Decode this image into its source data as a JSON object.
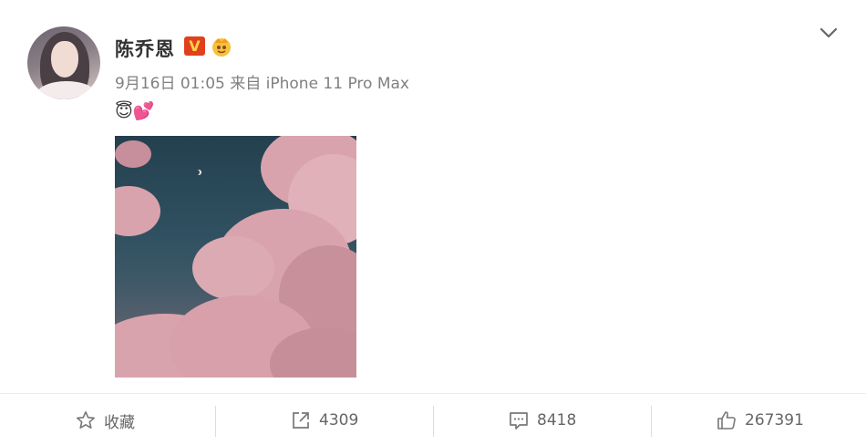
{
  "post": {
    "author": "陈乔恩",
    "meta": "9月16日 01:05 来自 iPhone 11 Pro Max",
    "text": "😇💕"
  },
  "badges": {
    "verified_label": "V",
    "verified_color": "#e0401c",
    "crown_icon": "crown-icon"
  },
  "footer": {
    "favorite_label": "收藏",
    "repost_count": "4309",
    "comment_count": "8418",
    "like_count": "267391"
  },
  "icons": [
    "star-icon",
    "share-icon",
    "comment-icon",
    "thumbs-up-icon",
    "chevron-down-icon"
  ]
}
